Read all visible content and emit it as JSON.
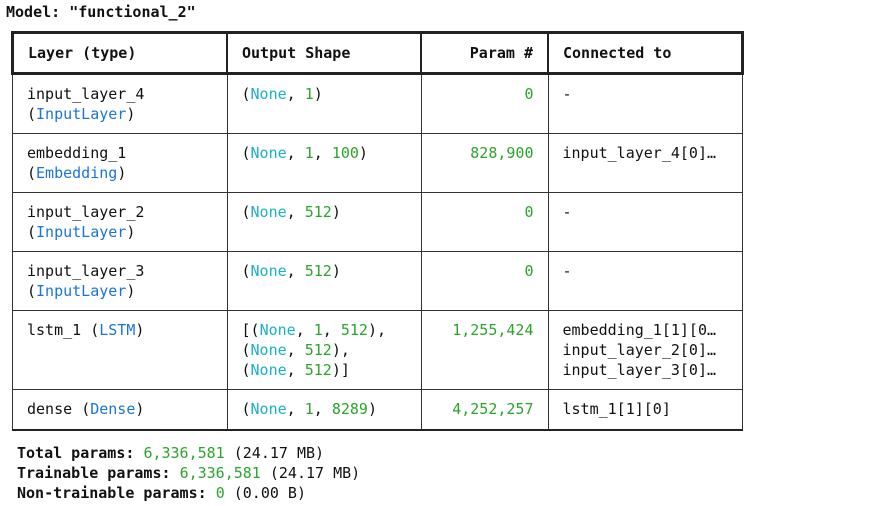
{
  "model_title": "Model: \"functional_2\"",
  "columns": {
    "layer": "Layer (type)",
    "output": "Output Shape",
    "param": "Param #",
    "connected": "Connected to"
  },
  "rows": [
    {
      "layer": {
        "name": "input_layer_4",
        "cls": "InputLayer",
        "cls_newline": true
      },
      "output": [
        [
          {
            "t": "("
          },
          {
            "t": "None",
            "k": "none"
          },
          {
            "t": ", "
          },
          {
            "t": "1",
            "k": "num"
          },
          {
            "t": ")"
          }
        ]
      ],
      "param": "0",
      "connected": [
        "-"
      ]
    },
    {
      "layer": {
        "name": "embedding_1",
        "cls": "Embedding",
        "cls_newline": true
      },
      "output": [
        [
          {
            "t": "("
          },
          {
            "t": "None",
            "k": "none"
          },
          {
            "t": ", "
          },
          {
            "t": "1",
            "k": "num"
          },
          {
            "t": ", "
          },
          {
            "t": "100",
            "k": "num"
          },
          {
            "t": ")"
          }
        ]
      ],
      "param": "828,900",
      "connected": [
        "input_layer_4[0]…"
      ]
    },
    {
      "layer": {
        "name": "input_layer_2",
        "cls": "InputLayer",
        "cls_newline": true
      },
      "output": [
        [
          {
            "t": "("
          },
          {
            "t": "None",
            "k": "none"
          },
          {
            "t": ", "
          },
          {
            "t": "512",
            "k": "num"
          },
          {
            "t": ")"
          }
        ]
      ],
      "param": "0",
      "connected": [
        "-"
      ]
    },
    {
      "layer": {
        "name": "input_layer_3",
        "cls": "InputLayer",
        "cls_newline": true
      },
      "output": [
        [
          {
            "t": "("
          },
          {
            "t": "None",
            "k": "none"
          },
          {
            "t": ", "
          },
          {
            "t": "512",
            "k": "num"
          },
          {
            "t": ")"
          }
        ]
      ],
      "param": "0",
      "connected": [
        "-"
      ]
    },
    {
      "layer": {
        "name": "lstm_1",
        "cls": "LSTM",
        "cls_newline": false
      },
      "output": [
        [
          {
            "t": "[("
          },
          {
            "t": "None",
            "k": "none"
          },
          {
            "t": ", "
          },
          {
            "t": "1",
            "k": "num"
          },
          {
            "t": ", "
          },
          {
            "t": "512",
            "k": "num"
          },
          {
            "t": "),"
          }
        ],
        [
          {
            "t": "("
          },
          {
            "t": "None",
            "k": "none"
          },
          {
            "t": ", "
          },
          {
            "t": "512",
            "k": "num"
          },
          {
            "t": "),"
          }
        ],
        [
          {
            "t": "("
          },
          {
            "t": "None",
            "k": "none"
          },
          {
            "t": ", "
          },
          {
            "t": "512",
            "k": "num"
          },
          {
            "t": ")]"
          }
        ]
      ],
      "param": "1,255,424",
      "connected": [
        "embedding_1[1][0…",
        "input_layer_2[0]…",
        "input_layer_3[0]…"
      ]
    },
    {
      "layer": {
        "name": "dense",
        "cls": "Dense",
        "cls_newline": false
      },
      "output": [
        [
          {
            "t": "("
          },
          {
            "t": "None",
            "k": "none"
          },
          {
            "t": ", "
          },
          {
            "t": "1",
            "k": "num"
          },
          {
            "t": ", "
          },
          {
            "t": "8289",
            "k": "num"
          },
          {
            "t": ")"
          }
        ]
      ],
      "param": "4,252,257",
      "connected": [
        "lstm_1[1][0]"
      ]
    }
  ],
  "totals": [
    {
      "label": "Total params:",
      "value": "6,336,581",
      "suffix": "(24.17 MB)"
    },
    {
      "label": "Trainable params:",
      "value": "6,336,581",
      "suffix": "(24.17 MB)"
    },
    {
      "label": "Non-trainable params:",
      "value": "0",
      "suffix": "(0.00 B)"
    }
  ],
  "colors": {
    "class_name": "#1a74d9",
    "none_keyword": "#18b2c8",
    "number": "#2aa52a"
  }
}
